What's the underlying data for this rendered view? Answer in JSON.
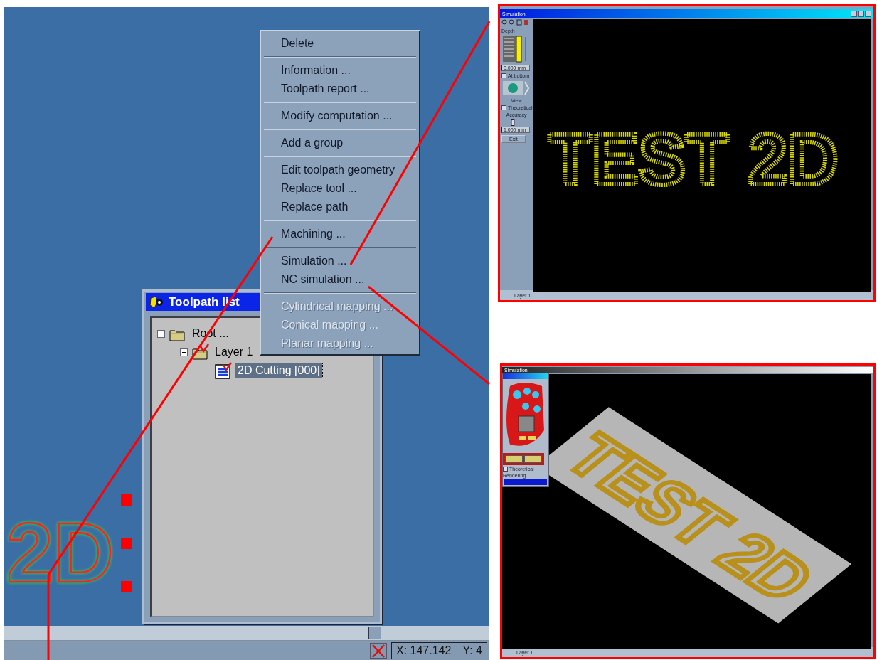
{
  "main_view": {
    "drawing_text": "2D"
  },
  "context_menu": {
    "groups": [
      [
        {
          "label": "Delete",
          "disabled": false
        }
      ],
      [
        {
          "label": "Information ...",
          "disabled": false
        },
        {
          "label": "Toolpath report ...",
          "disabled": false
        }
      ],
      [
        {
          "label": "Modify computation ...",
          "disabled": false
        }
      ],
      [
        {
          "label": "Add a group",
          "disabled": false
        }
      ],
      [
        {
          "label": "Edit toolpath geometry",
          "disabled": false
        },
        {
          "label": "Replace tool ...",
          "disabled": false
        },
        {
          "label": "Replace path",
          "disabled": false
        }
      ],
      [
        {
          "label": "Machining ...",
          "disabled": false
        }
      ],
      [
        {
          "label": "Simulation ...",
          "disabled": false
        },
        {
          "label": "NC simulation ...",
          "disabled": false
        }
      ],
      [
        {
          "label": "Cylindrical mapping ...",
          "disabled": true
        },
        {
          "label": "Conical mapping ...",
          "disabled": true
        },
        {
          "label": "Planar mapping ...",
          "disabled": true
        }
      ]
    ]
  },
  "toolpath_list": {
    "title": "Toolpath list",
    "tree": [
      {
        "label": "Root ...",
        "kind": "folder",
        "expanded": true,
        "checked": false,
        "selected": false,
        "children": [
          {
            "label": "Layer 1",
            "kind": "folder",
            "expanded": true,
            "checked": true,
            "selected": false,
            "children": [
              {
                "label": "2D Cutting [000]",
                "kind": "toolpath",
                "checked": true,
                "selected": true
              }
            ]
          }
        ]
      }
    ]
  },
  "status_bar": {
    "x": "X: 147.142",
    "y": "Y: 4"
  },
  "simulation_2d": {
    "title": "Simulation",
    "depth_label": "Depth",
    "depth_value": "0.000 mm",
    "at_bottom": {
      "label": "At bottom",
      "checked": false
    },
    "view_label": "View",
    "theoretical": {
      "label": "Theoretical",
      "checked": false
    },
    "accuracy": {
      "label": "Accuracy",
      "level": 0.45
    },
    "accuracy_value": "1.000 mm",
    "exit": "Exit",
    "layer": "Layer 1",
    "scene_text": "TEST 2D"
  },
  "simulation_3d": {
    "title": "Simulation",
    "theoretical": {
      "label": "Theoretical",
      "checked": false
    },
    "rendering": "Rendering ...",
    "progress": {
      "level": 1
    },
    "layer": "Layer 1",
    "scene_text": "TEST 2D"
  }
}
